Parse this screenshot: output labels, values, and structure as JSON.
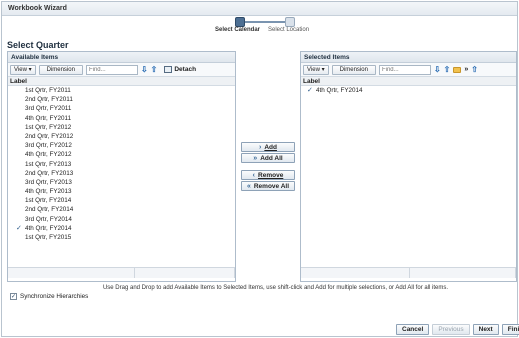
{
  "window": {
    "title": "Workbook Wizard"
  },
  "train": {
    "current": "Select Calendar",
    "next": "Select Location"
  },
  "page_title": "Select Quarter",
  "available": {
    "header": "Available Items",
    "view_label": "View",
    "dimension_label": "Dimension",
    "find_placeholder": "Find...",
    "detach_label": "Detach",
    "column_label": "Label",
    "items": [
      {
        "label": "1st Qrtr, FY2011",
        "checked": false
      },
      {
        "label": "2nd Qrtr, FY2011",
        "checked": false
      },
      {
        "label": "3rd Qrtr, FY2011",
        "checked": false
      },
      {
        "label": "4th Qrtr, FY2011",
        "checked": false
      },
      {
        "label": "1st Qrtr, FY2012",
        "checked": false
      },
      {
        "label": "2nd Qrtr, FY2012",
        "checked": false
      },
      {
        "label": "3rd Qrtr, FY2012",
        "checked": false
      },
      {
        "label": "4th Qrtr, FY2012",
        "checked": false
      },
      {
        "label": "1st Qrtr, FY2013",
        "checked": false
      },
      {
        "label": "2nd Qrtr, FY2013",
        "checked": false
      },
      {
        "label": "3rd Qrtr, FY2013",
        "checked": false
      },
      {
        "label": "4th Qrtr, FY2013",
        "checked": false
      },
      {
        "label": "1st Qrtr, FY2014",
        "checked": false
      },
      {
        "label": "2nd Qrtr, FY2014",
        "checked": false
      },
      {
        "label": "3rd Qrtr, FY2014",
        "checked": false
      },
      {
        "label": "4th Qrtr, FY2014",
        "checked": true
      },
      {
        "label": "1st Qrtr, FY2015",
        "checked": false
      }
    ]
  },
  "selected": {
    "header": "Selected Items",
    "view_label": "View",
    "dimension_label": "Dimension",
    "find_placeholder": "Find...",
    "column_label": "Label",
    "items": [
      {
        "label": "4th Qrtr, FY2014",
        "checked": true
      }
    ]
  },
  "shuttle": {
    "add": "Add",
    "add_all": "Add All",
    "remove": "Remove",
    "remove_all": "Remove All"
  },
  "hint": "Use Drag and Drop to add Available Items to Selected Items, use shift-click and Add for multiple selections, or Add All for all items.",
  "sync_label": "Synchronize Hierarchies",
  "sync_checked": true,
  "footer": {
    "cancel": "Cancel",
    "previous": "Previous",
    "next": "Next",
    "finish": "Finish"
  },
  "colors": {
    "accent": "#4d6f93",
    "header_bg": "#e4eaf0",
    "arrow": "#2e6fb5"
  },
  "icons": {
    "check": "checkmark-icon",
    "down": "arrow-down-icon",
    "up": "arrow-up-icon",
    "detach": "detach-icon",
    "folder": "folder-icon"
  }
}
